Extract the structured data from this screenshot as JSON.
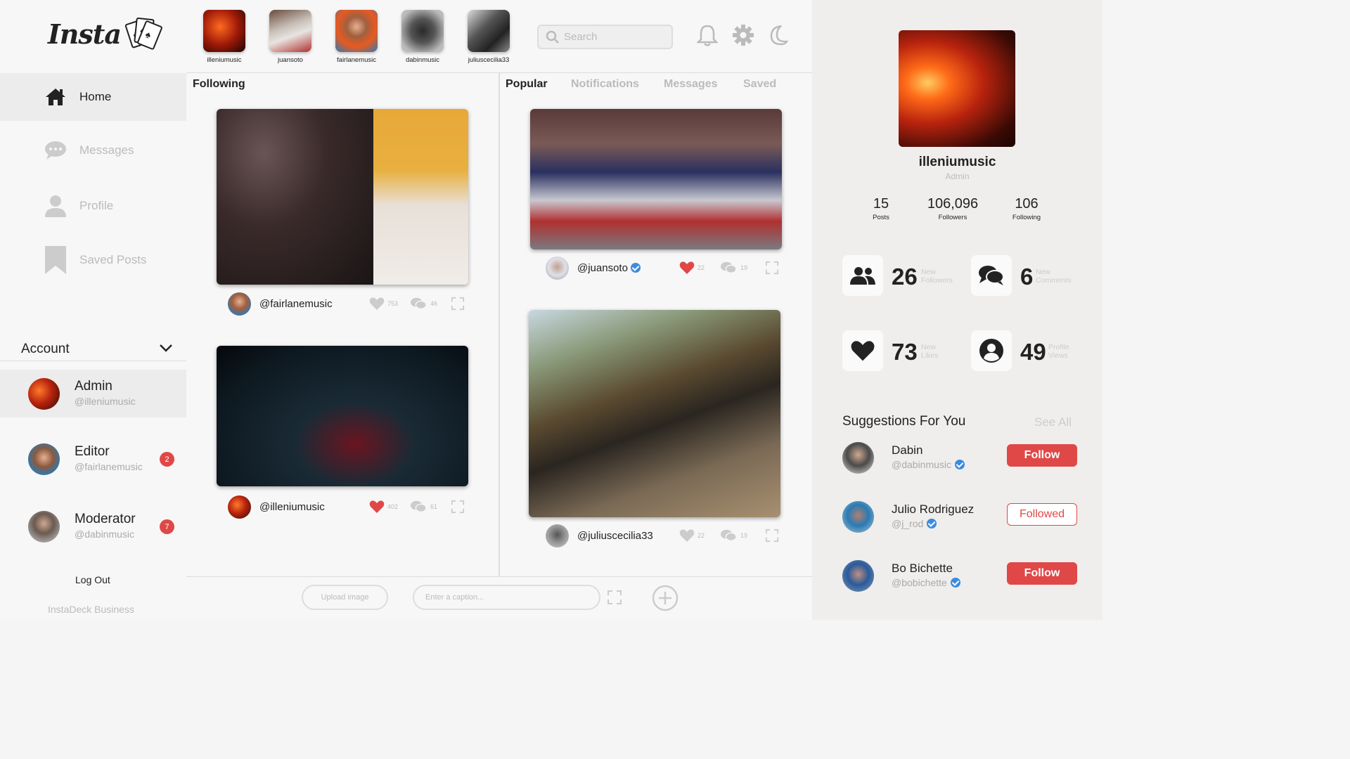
{
  "brand": {
    "logo_text": "Insta",
    "footer": "InstaDeck Business"
  },
  "nav": {
    "home": "Home",
    "messages": "Messages",
    "profile": "Profile",
    "saved": "Saved Posts"
  },
  "account": {
    "title": "Account",
    "items": [
      {
        "role": "Admin",
        "handle": "@illeniumusic"
      },
      {
        "role": "Editor",
        "handle": "@fairlanemusic",
        "badge": "2"
      },
      {
        "role": "Moderator",
        "handle": "@dabinmusic",
        "badge": "7"
      }
    ],
    "logout": "Log Out"
  },
  "stories": [
    "illeniumusic",
    "juansoto",
    "fairlanemusic",
    "dabinmusic",
    "juliuscecilia33"
  ],
  "search": {
    "placeholder": "Search"
  },
  "icons": {
    "bell": "bell-icon",
    "settings": "gear-icon",
    "theme": "moon-icon"
  },
  "following": {
    "title": "Following",
    "posts": [
      {
        "user": "@fairlanemusic",
        "likes": "753",
        "comments": "46"
      },
      {
        "user": "@illeniumusic",
        "likes": "402",
        "comments": "61"
      }
    ]
  },
  "tabs": [
    "Popular",
    "Notifications",
    "Messages",
    "Saved"
  ],
  "popular": {
    "posts": [
      {
        "user": "@juansoto",
        "likes": "22",
        "comments": "19"
      },
      {
        "user": "@juliuscecilia33",
        "likes": "22",
        "comments": "19"
      }
    ]
  },
  "composer": {
    "upload": "Upload image",
    "caption_placeholder": "Enter a caption..."
  },
  "profile": {
    "name": "illeniumusic",
    "role": "Admin",
    "stats": [
      {
        "value": "15",
        "label": "Posts"
      },
      {
        "value": "106,096",
        "label": "Followers"
      },
      {
        "value": "106",
        "label": "Following"
      }
    ],
    "metrics": [
      {
        "value": "26",
        "label1": "New",
        "label2": "Followers"
      },
      {
        "value": "6",
        "label1": "New",
        "label2": "Comments"
      },
      {
        "value": "73",
        "label1": "New",
        "label2": "Likes"
      },
      {
        "value": "49",
        "label1": "Profile",
        "label2": "Views"
      }
    ]
  },
  "suggestions": {
    "title": "Suggestions For You",
    "see_all": "See All",
    "items": [
      {
        "name": "Dabin",
        "handle": "@dabinmusic",
        "button": "Follow"
      },
      {
        "name": "Julio Rodriguez",
        "handle": "@j_rod",
        "button": "Followed"
      },
      {
        "name": "Bo Bichette",
        "handle": "@bobichette",
        "button": "Follow"
      }
    ]
  },
  "colors": {
    "accent": "#e04848",
    "verified": "#3b8be0"
  }
}
